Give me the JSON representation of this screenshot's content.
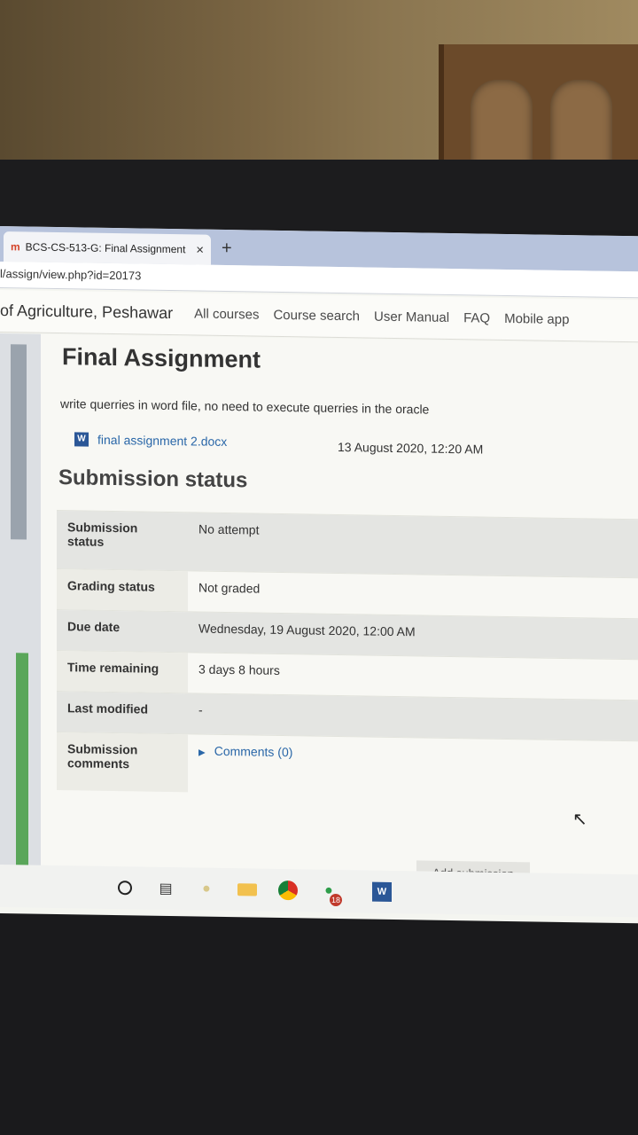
{
  "browser": {
    "tab_favicon": "m",
    "tab_title": "BCS-CS-513-G: Final Assignment",
    "tab_close": "×",
    "new_tab": "+",
    "url": "l/assign/view.php?id=20173"
  },
  "navbar": {
    "brand": "of Agriculture, Peshawar",
    "links": [
      "All courses",
      "Course search",
      "User Manual",
      "FAQ",
      "Mobile app"
    ]
  },
  "assignment": {
    "title": "Final Assignment",
    "intro": "write querries in word file, no need to execute querries in the oracle",
    "file_name": "final assignment 2.docx",
    "file_date": "13 August 2020, 12:20 AM"
  },
  "submission": {
    "section_title": "Submission status",
    "rows": [
      {
        "label": "Submission status",
        "value": "No attempt"
      },
      {
        "label": "Grading status",
        "value": "Not graded"
      },
      {
        "label": "Due date",
        "value": "Wednesday, 19 August 2020, 12:00 AM"
      },
      {
        "label": "Time remaining",
        "value": "3 days 8 hours"
      },
      {
        "label": "Last modified",
        "value": "-"
      },
      {
        "label": "Submission comments",
        "value": "Comments (0)"
      }
    ],
    "add_button": "Add submission"
  },
  "taskbar": {
    "notification_count": "18",
    "icons": [
      "search-icon",
      "task-view-icon",
      "app-icon",
      "file-explorer-icon",
      "chrome-icon",
      "messaging-icon",
      "word-icon"
    ]
  }
}
